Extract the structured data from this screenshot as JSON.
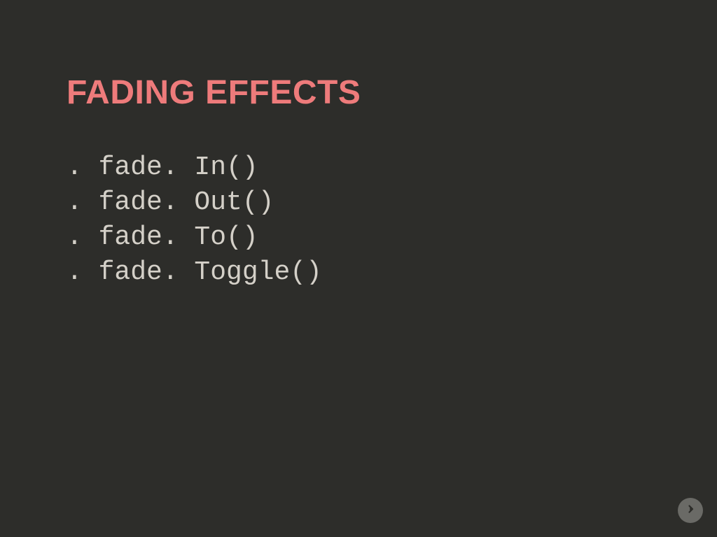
{
  "title": "FADING EFFECTS",
  "code_lines": [
    ". fade. In()",
    ". fade. Out()",
    ". fade. To()",
    ". fade. Toggle()"
  ],
  "icons": {
    "next": "arrow-right-circle"
  }
}
